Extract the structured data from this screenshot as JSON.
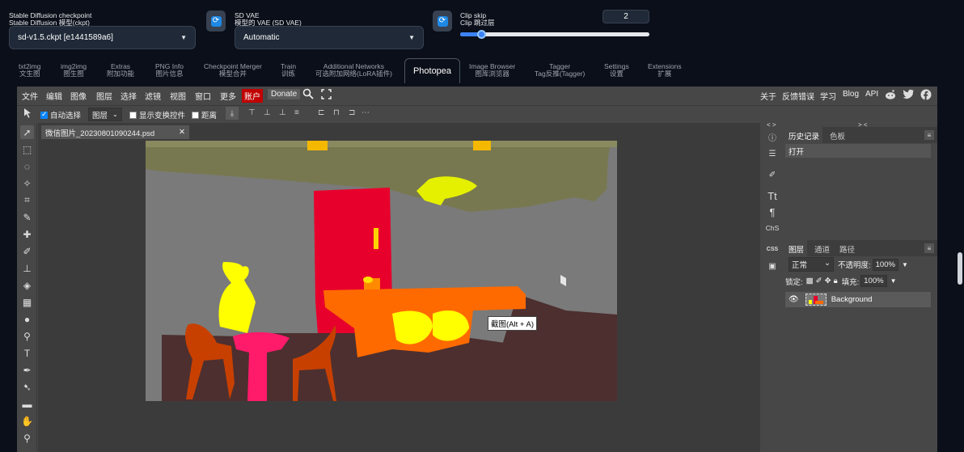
{
  "settings": {
    "checkpoint": {
      "label_en": "Stable Diffusion checkpoint",
      "label_zh": "Stable Diffusion 模型(ckpt)",
      "value": "sd-v1.5.ckpt [e1441589a6]"
    },
    "vae": {
      "label_en": "SD VAE",
      "label_zh": "模型的 VAE (SD VAE)",
      "value": "Automatic"
    },
    "clip": {
      "label_en": "Clip skip",
      "label_zh": "Clip 跳过层",
      "value": "2",
      "slider_level": 0.11
    },
    "refresh_glyph": "⟳"
  },
  "tabs": [
    {
      "en": "txt2img",
      "zh": "文生图"
    },
    {
      "en": "img2img",
      "zh": "图生图"
    },
    {
      "en": "Extras",
      "zh": "附加功能"
    },
    {
      "en": "PNG Info",
      "zh": "图片信息"
    },
    {
      "en": "Checkpoint Merger",
      "zh": "模型合并"
    },
    {
      "en": "Train",
      "zh": "训练"
    },
    {
      "en": "Additional Networks",
      "zh": "可选附加网络(LoRA插件)"
    },
    {
      "label": "Photopea"
    },
    {
      "en": "Image Browser",
      "zh": "图库浏览器"
    },
    {
      "en": "Tagger",
      "zh": "Tag反推(Tagger)"
    },
    {
      "en": "Settings",
      "zh": "设置"
    },
    {
      "en": "Extensions",
      "zh": "扩展"
    }
  ],
  "photopea": {
    "menu": [
      "文件",
      "编辑",
      "图像",
      "图层",
      "选择",
      "滤镜",
      "视图",
      "窗口",
      "更多",
      "账户",
      "Donate"
    ],
    "menu_right": [
      "关于",
      "反馈错误",
      "学习",
      "Blog",
      "API"
    ],
    "options": {
      "auto_select": "自动选择",
      "layer_select": "图层",
      "show_transform": "显示变换控件",
      "distance": "距离"
    },
    "doc_tab": "微信图片_20230801090244.psd",
    "close_glyph": "✕",
    "tooltip": "截图(Alt + A)",
    "history_tabs": [
      "历史记录",
      "色板"
    ],
    "history_items": [
      "打开"
    ],
    "mid_labels": {
      "chs": "ChS",
      "css": "CSS",
      "collapse_left": "< >",
      "collapse_right": "> <"
    },
    "layer_tabs": [
      "图层",
      "通道",
      "路径"
    ],
    "blend_mode": "正常",
    "opacity_label": "不透明度:",
    "opacity_value": "100%",
    "lock_label": "锁定:",
    "fill_label": "填充:",
    "fill_value": "100%",
    "layers": [
      {
        "name": "Background"
      }
    ]
  },
  "colors": {
    "app_bg": "#0b0f19",
    "accent_blue": "#3b82f6",
    "photopea_panel": "#474747",
    "account_red": "#c00000"
  }
}
